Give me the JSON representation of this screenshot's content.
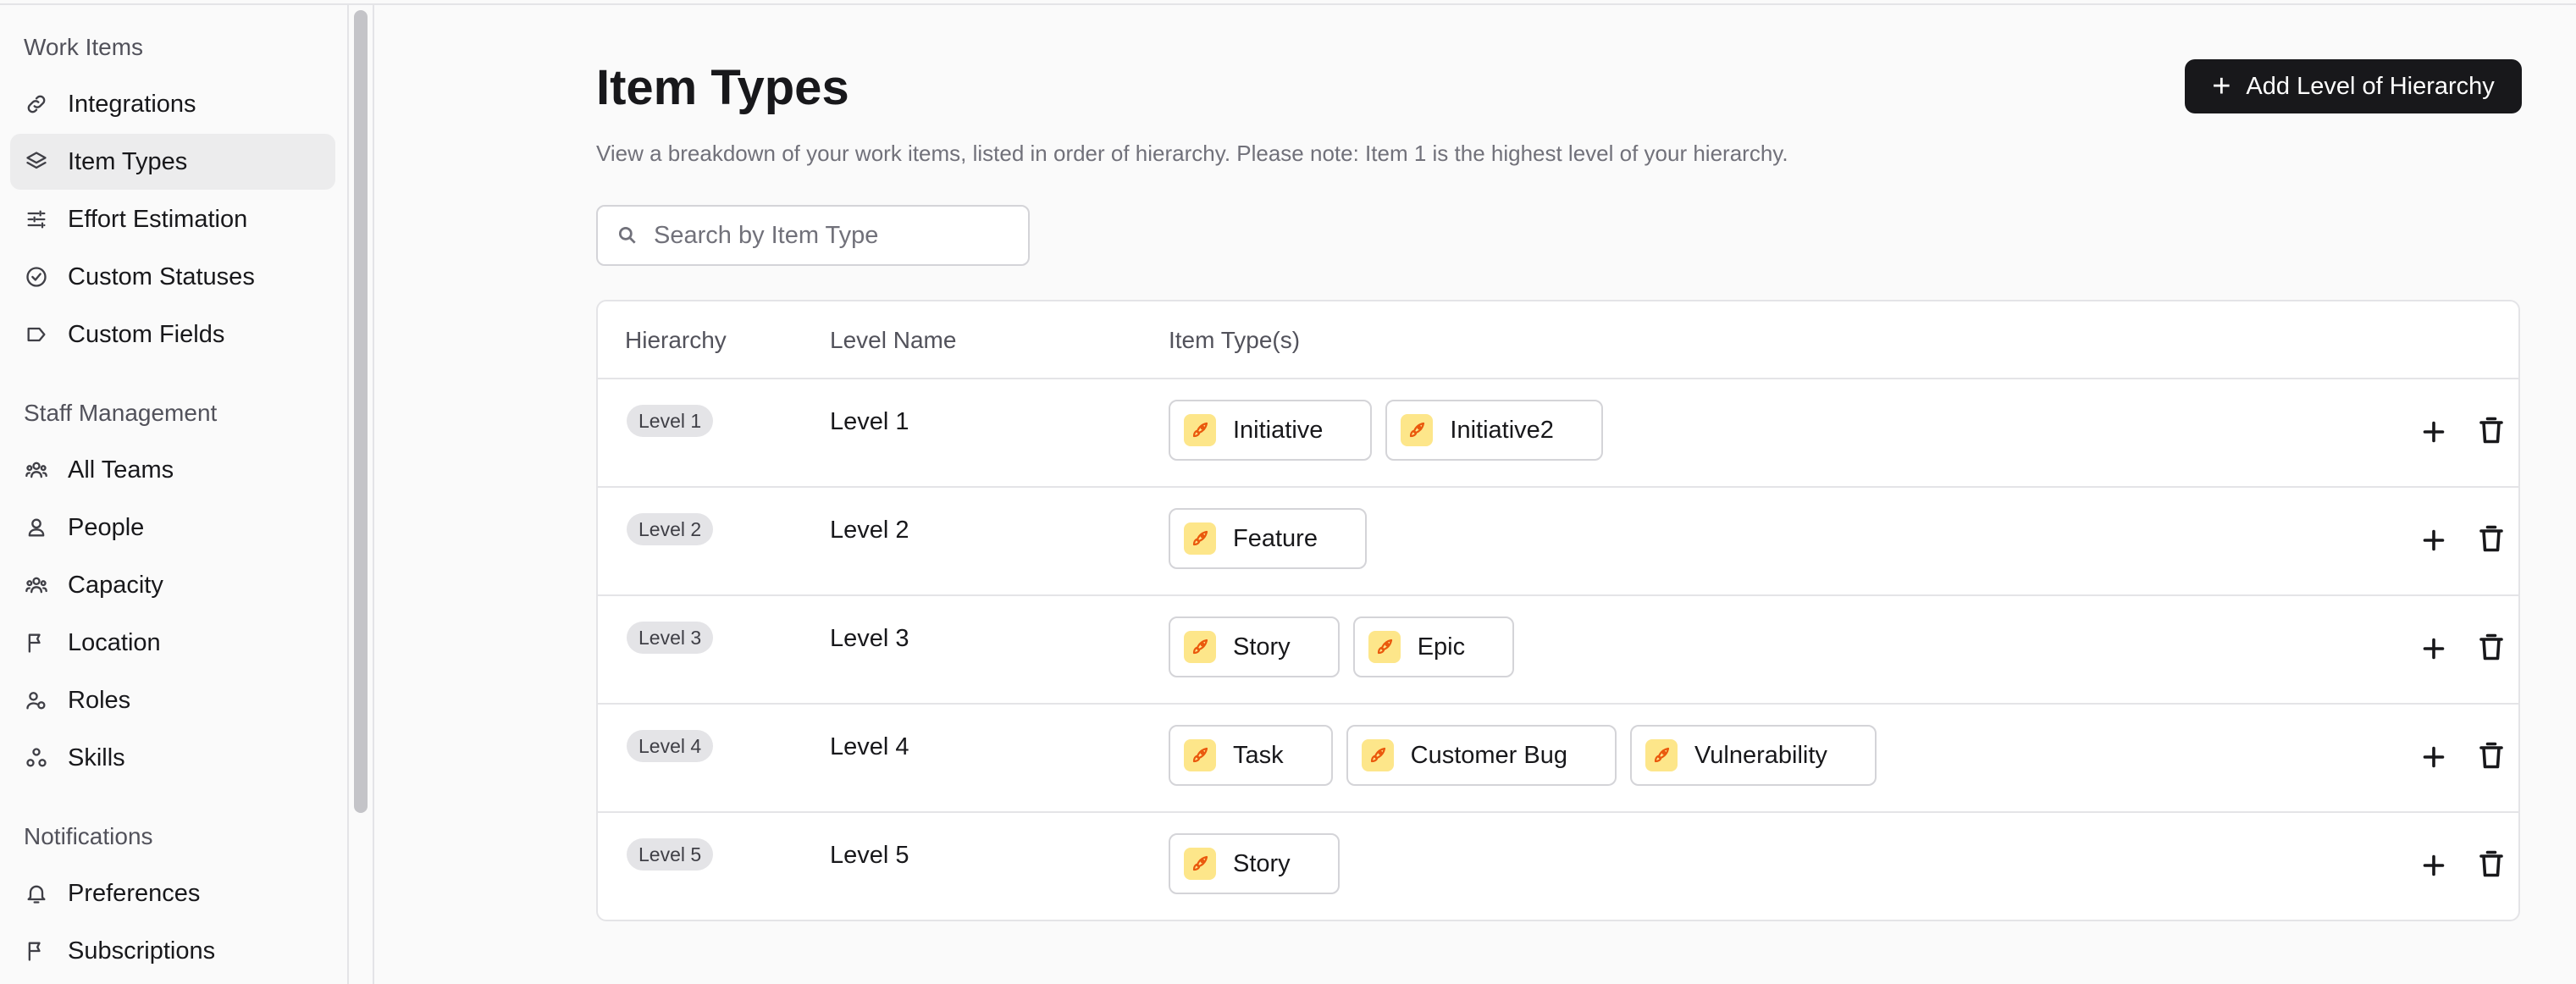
{
  "sidebar": {
    "groups": [
      {
        "label": "Work Items"
      },
      {
        "label": "Staff Management"
      },
      {
        "label": "Notifications"
      }
    ],
    "items": [
      {
        "label": "Integrations",
        "icon": "link-icon"
      },
      {
        "label": "Item Types",
        "icon": "layers-icon",
        "active": true
      },
      {
        "label": "Effort Estimation",
        "icon": "sliders-icon"
      },
      {
        "label": "Custom Statuses",
        "icon": "check-circle-icon"
      },
      {
        "label": "Custom Fields",
        "icon": "tag-icon"
      },
      {
        "label": "All Teams",
        "icon": "users-icon"
      },
      {
        "label": "People",
        "icon": "user-icon"
      },
      {
        "label": "Capacity",
        "icon": "users-icon"
      },
      {
        "label": "Location",
        "icon": "flag-icon"
      },
      {
        "label": "Roles",
        "icon": "user-roles-icon"
      },
      {
        "label": "Skills",
        "icon": "skills-icon"
      },
      {
        "label": "Preferences",
        "icon": "bell-icon"
      },
      {
        "label": "Subscriptions",
        "icon": "flag-icon"
      }
    ]
  },
  "header": {
    "title": "Item Types",
    "description": "View a breakdown of your work items, listed in order of hierarchy. Please note: Item 1 is the highest level of your hierarchy.",
    "add_button": "Add Level of Hierarchy"
  },
  "search": {
    "placeholder": "Search by Item Type",
    "value": ""
  },
  "table": {
    "columns": [
      "Hierarchy",
      "Level Name",
      "Item Type(s)"
    ],
    "rows": [
      {
        "badge": "Level 1",
        "name": "Level 1",
        "types": [
          "Initiative",
          "Initiative2"
        ]
      },
      {
        "badge": "Level 2",
        "name": "Level 2",
        "types": [
          "Feature"
        ]
      },
      {
        "badge": "Level 3",
        "name": "Level 3",
        "types": [
          "Story",
          "Epic"
        ]
      },
      {
        "badge": "Level 4",
        "name": "Level 4",
        "types": [
          "Task",
          "Customer Bug",
          "Vulnerability"
        ]
      },
      {
        "badge": "Level 5",
        "name": "Level 5",
        "types": [
          "Story"
        ]
      }
    ]
  },
  "colors": {
    "primary_button": "#18181b",
    "chip_icon_bg": "#fde68a",
    "chip_icon_fg": "#ea580c",
    "active_nav": "#ececed"
  }
}
